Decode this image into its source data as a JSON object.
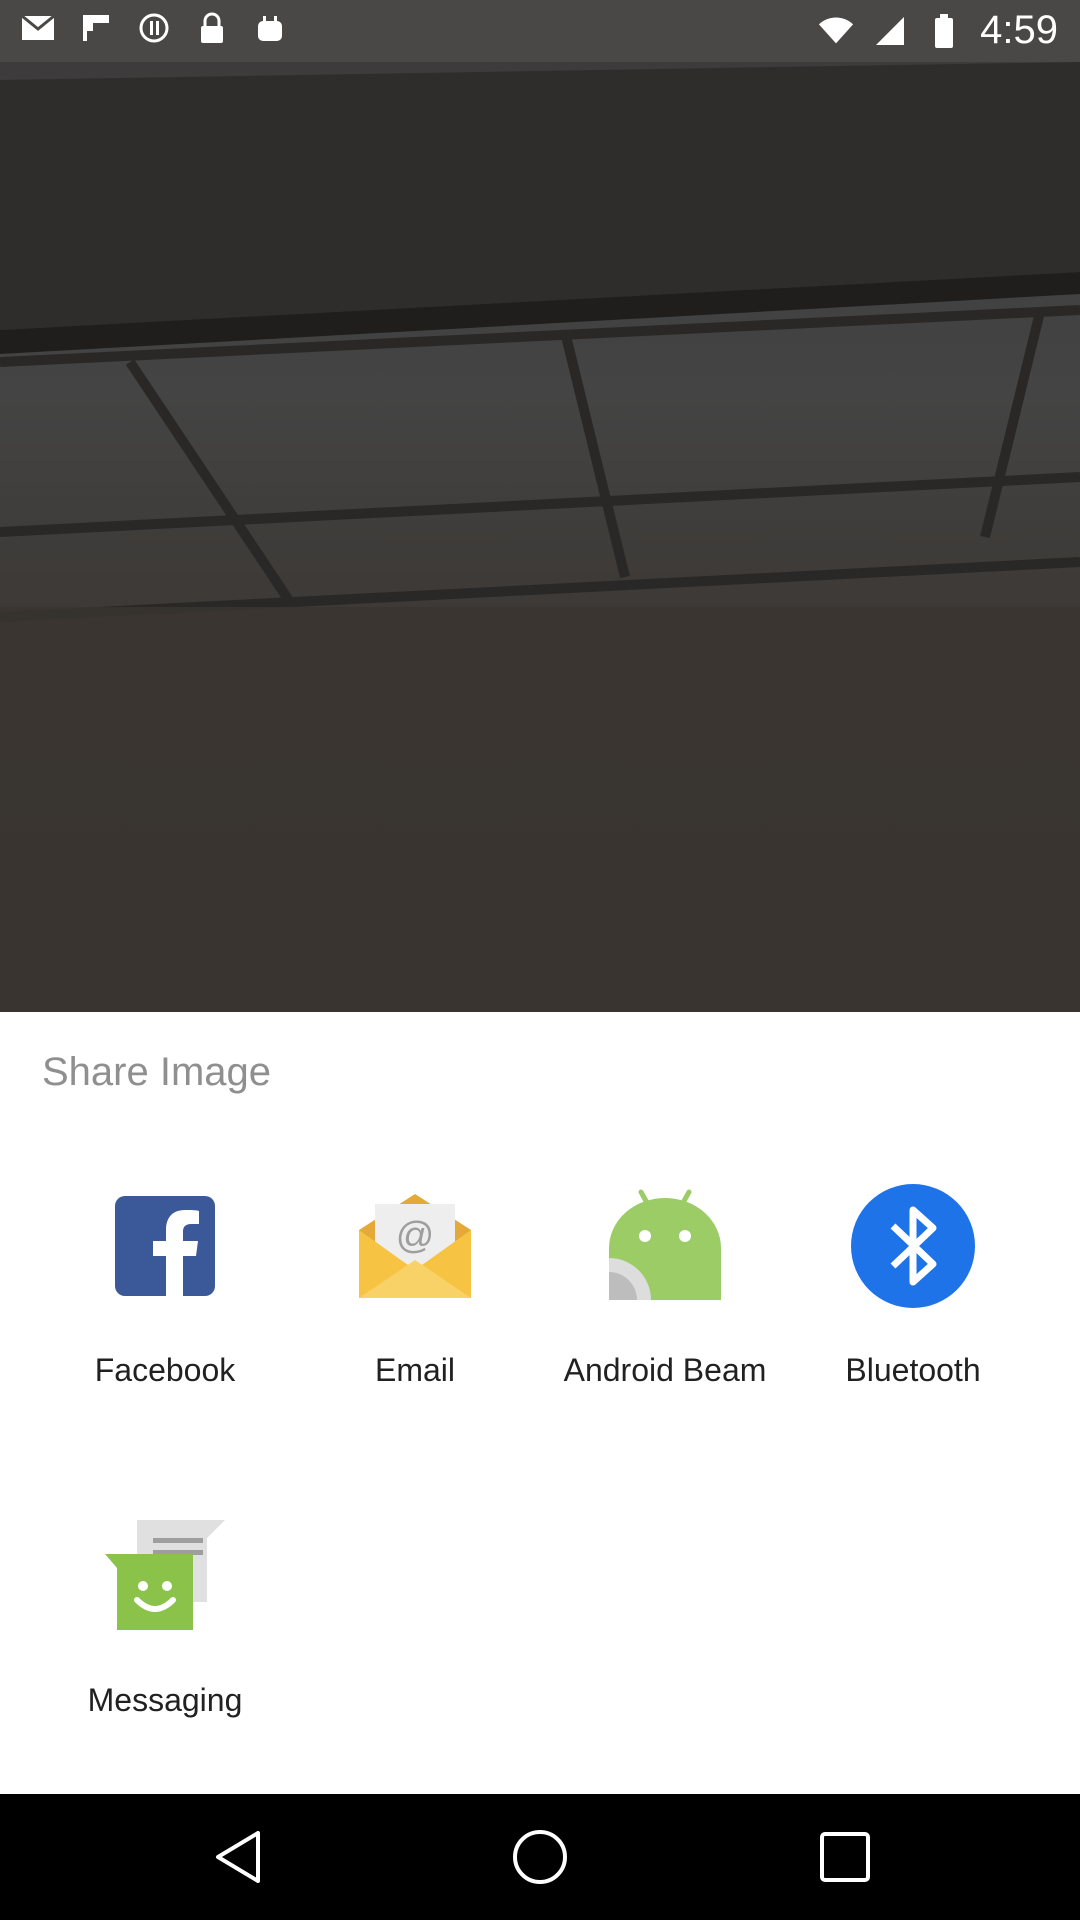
{
  "status_bar": {
    "time": "4:59",
    "left_icons": [
      "mail-icon",
      "flipboard-icon",
      "record-icon",
      "lock-icon",
      "android-icon"
    ],
    "right_icons": [
      "wifi-icon",
      "signal-icon",
      "battery-icon"
    ]
  },
  "share_sheet": {
    "title": "Share Image",
    "apps": [
      {
        "label": "Facebook",
        "icon": "facebook-icon"
      },
      {
        "label": "Email",
        "icon": "email-icon"
      },
      {
        "label": "Android Beam",
        "icon": "android-beam-icon"
      },
      {
        "label": "Bluetooth",
        "icon": "bluetooth-icon"
      },
      {
        "label": "Messaging",
        "icon": "messaging-icon"
      }
    ]
  },
  "nav_bar": {
    "buttons": [
      "back-icon",
      "home-icon",
      "recents-icon"
    ]
  },
  "colors": {
    "facebook": "#3b5998",
    "bluetooth": "#1e73e8",
    "android_green": "#9ccc65",
    "messaging_green": "#8bc34a",
    "email_yellow": "#f6c343"
  }
}
